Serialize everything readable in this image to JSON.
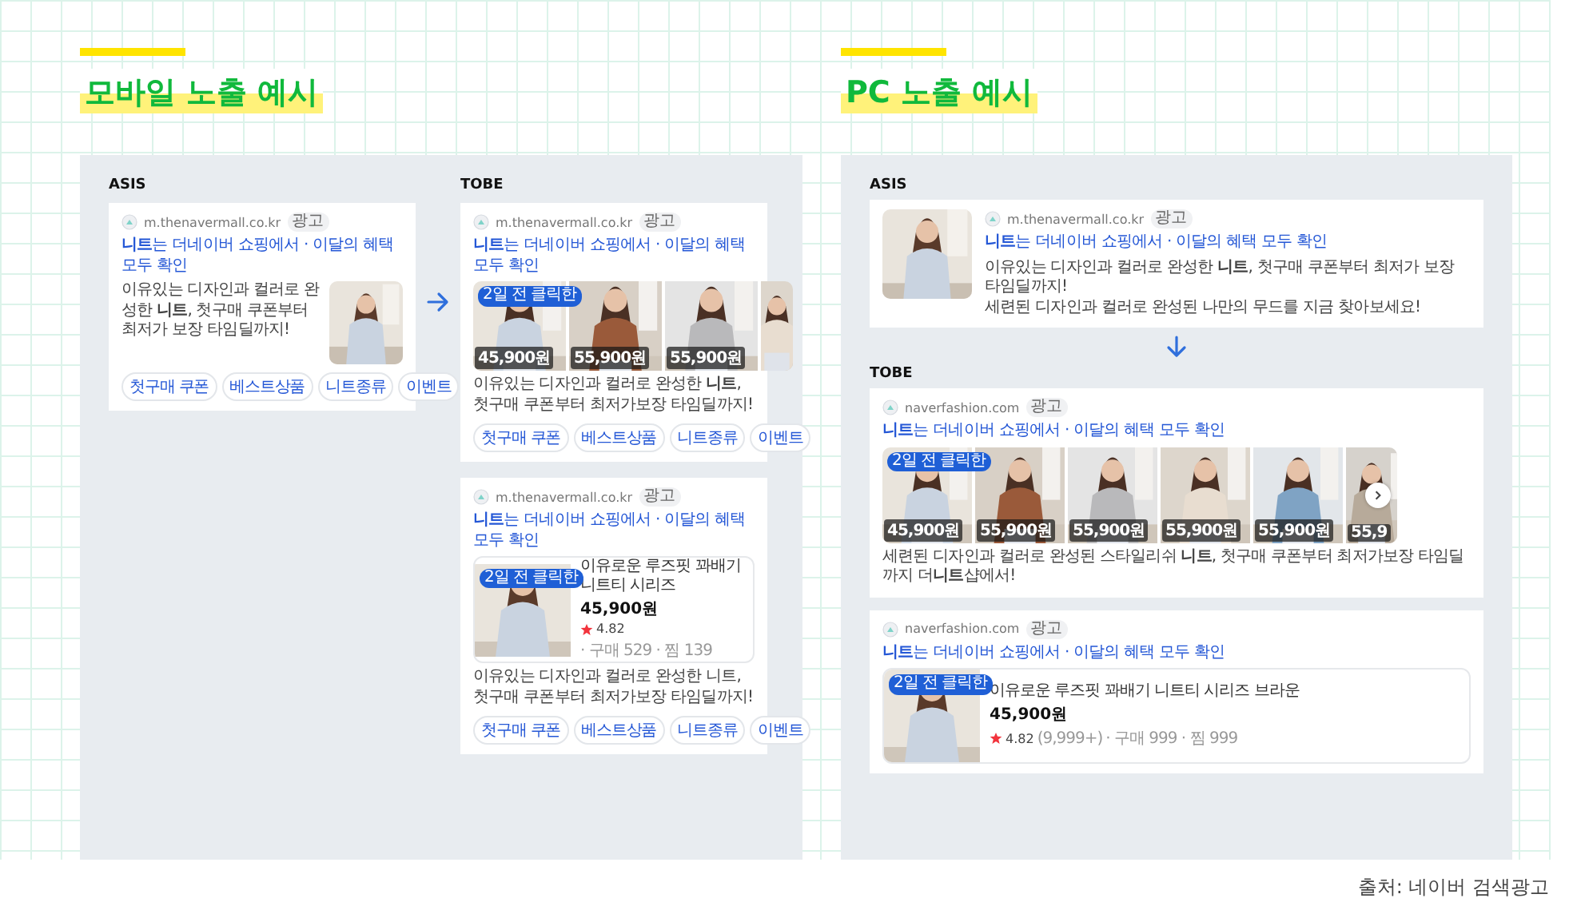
{
  "sections": [
    {
      "kind": "mobile",
      "title": "모바일 노출 예시",
      "groups": [
        {
          "label": "ASIS",
          "ads": [
            {
              "kind": "thumb_right",
              "domain": "m.thenavermall.co.kr",
              "ad_tag": "광고",
              "headline": "**니트**는 더네이버 쇼핑에서 · 이달의 혜택 모두 확인",
              "description": [
                "이유있는 디자인과 컬러로 완성한 **니트**, 첫구매 쿠폰부터 최저가 보장 타임딜까지!"
              ],
              "tags": [
                "첫구매 쿠폰",
                "베스트상품",
                "니트종류",
                "이벤트"
              ]
            }
          ]
        },
        {
          "label": "TOBE",
          "ads": [
            {
              "kind": "gallery",
              "domain": "m.thenavermall.co.kr",
              "ad_tag": "광고",
              "headline": "**니트**는 더네이버 쇼핑에서 · 이달의 혜택 모두 확인",
              "images": [
                {
                  "kind": "picture",
                  "badge": "2일 전 클릭한",
                  "price": "45,900원"
                },
                {
                  "kind": "picture",
                  "price": "55,900원"
                },
                {
                  "kind": "picture",
                  "price": "55,900원"
                },
                {
                  "kind": "picture"
                }
              ],
              "has_next": false,
              "description": [
                "이유있는 디자인과 컬러로 완성한 **니트**, 첫구매 쿠폰부터 최저가보장 타임딜까지!"
              ],
              "tags": [
                "첫구매 쿠폰",
                "베스트상품",
                "니트종류",
                "이벤트"
              ]
            },
            {
              "kind": "product",
              "domain": "m.thenavermall.co.kr",
              "ad_tag": "광고",
              "headline": "**니트**는 더네이버 쇼핑에서 · 이달의 혜택 모두 확인",
              "product": {
                "badge": "2일 전 클릭한",
                "name": "이유로운 루즈핏 꽈배기 니트티 시리즈",
                "price": "45,900원",
                "rating": "4.82",
                "meta": "· 구매 529 · 찜 139"
              },
              "description": [
                "이유있는 디자인과 컬러로 완성한 니트, 첫구매 쿠폰부터 최저가보장 타임딜까지!"
              ],
              "tags": [
                "첫구매 쿠폰",
                "베스트상품",
                "니트종류",
                "이벤트"
              ]
            }
          ]
        }
      ]
    },
    {
      "kind": "pc",
      "title": "PC 노출 예시",
      "groups": [
        {
          "label": "ASIS",
          "ads": [
            {
              "kind": "thumb_left",
              "domain": "m.thenavermall.co.kr",
              "ad_tag": "광고",
              "headline": "**니트**는 더네이버 쇼핑에서 · 이달의 혜택 모두 확인",
              "description": [
                "이유있는 디자인과 컬러로 완성한 **니트**, 첫구매 쿠폰부터 최저가 보장 타임딜까지!",
                "세련된 디자인과 컬러로 완성된 나만의 무드를 지금 찾아보세요!"
              ]
            }
          ]
        },
        {
          "label": "TOBE",
          "ads": [
            {
              "kind": "gallery",
              "domain": "naverfashion.com",
              "ad_tag": "광고",
              "headline": "**니트**는 더네이버 쇼핑에서 · 이달의 혜택 모두 확인",
              "images": [
                {
                  "kind": "picture",
                  "badge": "2일 전 클릭한",
                  "price": "45,900원"
                },
                {
                  "kind": "picture",
                  "price": "55,900원"
                },
                {
                  "kind": "picture",
                  "price": "55,900원"
                },
                {
                  "kind": "picture",
                  "price": "55,900원"
                },
                {
                  "kind": "picture",
                  "price": "55,900원"
                },
                {
                  "kind": "picture",
                  "price": "55,9"
                }
              ],
              "has_next": true,
              "description": [
                "세련된 디자인과 컬러로 완성된 스타일리쉬 **니트**, 첫구매 쿠폰부터 최저가보장 타임딜까지 더**니트**샵에서!"
              ]
            },
            {
              "kind": "product",
              "domain": "naverfashion.com",
              "ad_tag": "광고",
              "headline": "**니트**는 더네이버 쇼핑에서 · 이달의 혜택 모두 확인",
              "product": {
                "badge": "2일 전 클릭한",
                "name": "이유로운 루즈핏 꽈배기 니트티 시리즈 브라운",
                "price": "45,900원",
                "rating": "4.82",
                "reviews": "(9,999+)",
                "meta": "· 구매 999 · 찜 999"
              }
            }
          ]
        }
      ]
    }
  ],
  "source": "출처: 네이버 검색광고"
}
